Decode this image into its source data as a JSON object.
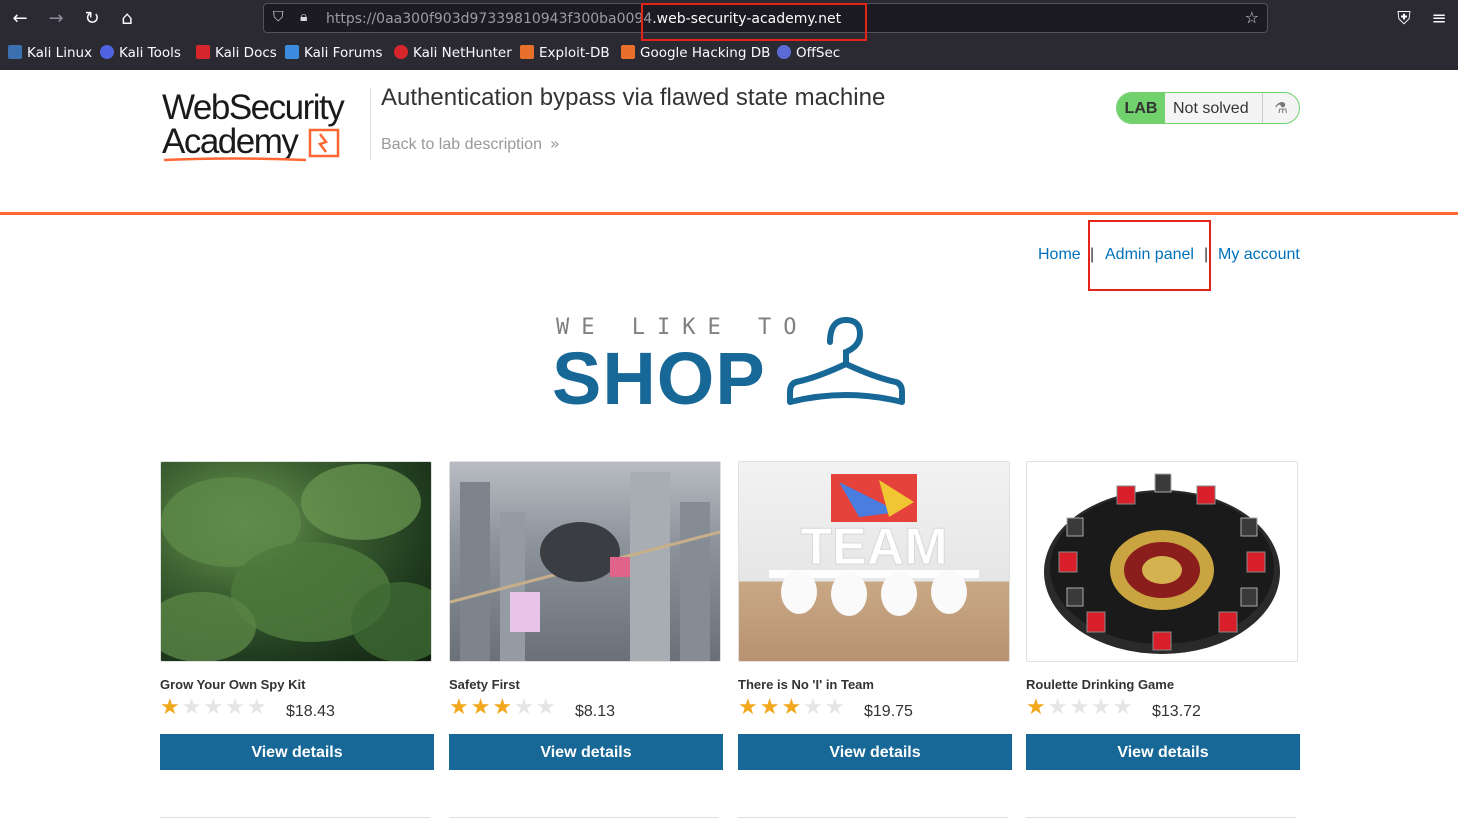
{
  "browser": {
    "url_dim": "https://0aa300f903d97339810943f300ba0094",
    "url_bright": ".web-security-academy.net",
    "bookmarks": [
      "Kali Linux",
      "Kali Tools",
      "Kali Docs",
      "Kali Forums",
      "Kali NetHunter",
      "Exploit-DB",
      "Google Hacking DB",
      "OffSec"
    ],
    "icons": [
      "back-icon",
      "forward-icon",
      "reload-icon",
      "home-icon",
      "shield-icon",
      "lock-icon",
      "star-icon",
      "pocket-icon",
      "menu-icon"
    ]
  },
  "lab": {
    "logo_line1": "WebSecurity",
    "logo_line2": "Academy",
    "title": "Authentication bypass via flawed state machine",
    "back_link": "Back to lab description",
    "badge_lab": "LAB",
    "badge_status": "Not solved",
    "accent_color": "#ff6633",
    "solved_color": "#70d16d"
  },
  "nav": {
    "home": "Home",
    "sep": "|",
    "admin_panel": "Admin panel",
    "my_account": "My account"
  },
  "banner": {
    "small": "WE LIKE TO",
    "big": "SHOP",
    "color": "#176797"
  },
  "products": [
    {
      "name": "Grow Your Own Spy Kit",
      "rating": 1,
      "price": "$18.43",
      "button": "View details"
    },
    {
      "name": "Safety First",
      "rating": 3,
      "price": "$8.13",
      "button": "View details"
    },
    {
      "name": "There is No 'I' in Team",
      "rating": 3,
      "price": "$19.75",
      "button": "View details"
    },
    {
      "name": "Roulette Drinking Game",
      "rating": 1,
      "price": "$13.72",
      "button": "View details"
    }
  ]
}
